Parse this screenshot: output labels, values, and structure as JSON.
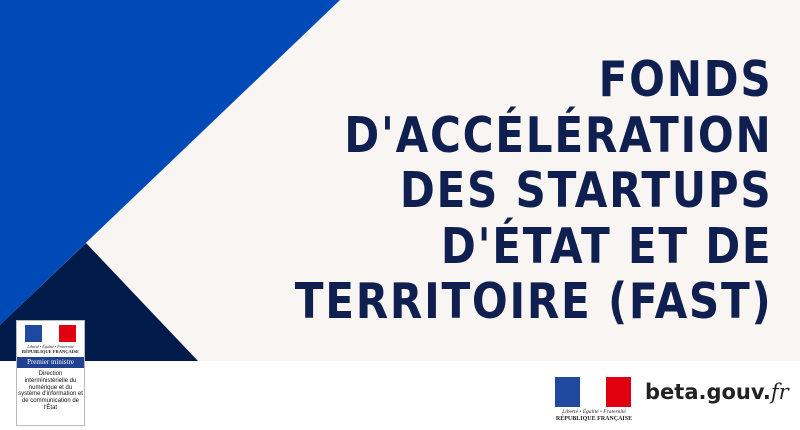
{
  "title_lines": [
    "FONDS",
    "D'ACCÉLÉRATION",
    "DES STARTUPS",
    "D'ÉTAT ET DE",
    "TERRITOIRE (FAST)"
  ],
  "colors": {
    "blue": "#004ab8",
    "navy": "#001b4a",
    "background": "#f9f5f2",
    "title": "#0f1f4f",
    "flag_blue": "#1f4aa0",
    "flag_red": "#e1000f"
  },
  "premier_ministre_logo": {
    "motto": "Liberté • Égalité • Fraternité",
    "republique": "RÉPUBLIQUE FRANÇAISE",
    "band": "Premier ministre",
    "direction": "Direction interministérielle du numérique et du système d'information et de communication de l'État"
  },
  "rf_logo": {
    "motto": "Liberté • Égalité • Fraternité",
    "republique": "RÉPUBLIQUE FRANÇAISE"
  },
  "beta_logo": {
    "name": "beta.gouv.",
    "tld": "fr"
  }
}
